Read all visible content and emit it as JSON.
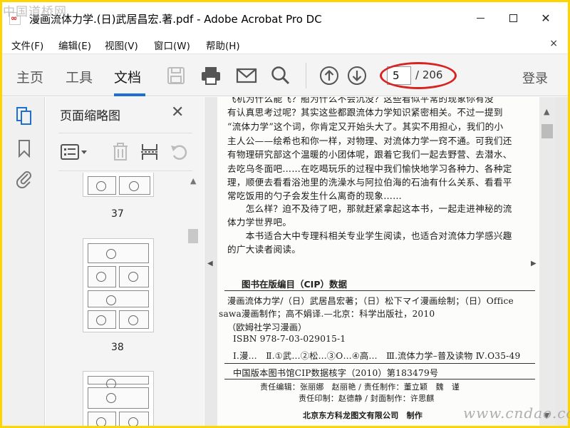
{
  "window": {
    "title": "漫画流体力学.(日)武居昌宏.著.pdf - Adobe Acrobat Pro DC",
    "close_glyph": "✕"
  },
  "menu": {
    "items": [
      "文件(F)",
      "编辑(E)",
      "视图(V)",
      "窗口(W)",
      "帮助(H)"
    ],
    "close_glyph": "×"
  },
  "toolbar": {
    "tabs": [
      "主页",
      "工具",
      "文档"
    ],
    "active_tab": "文档",
    "page_input_value": "5",
    "page_total": "/ 206",
    "login_label": "登录",
    "accent_color": "#1f6fd1",
    "highlight_color": "#d82323"
  },
  "thumbnails": {
    "panel_title": "页面缩略图",
    "close_glyph": "✕",
    "pages": [
      {
        "number": "37"
      },
      {
        "number": "38"
      }
    ]
  },
  "document": {
    "paragraph_lines": [
      "飞机为什么能飞？船为什么不会沉没？这些看似平常的现象你有没",
      "有认真思考过呢？其实这些都跟流体力学知识紧密相关。不过一提到",
      "“流体力学”这个词，你肯定又开始头大了。其实不用担心，我们的小",
      "主人公——绘希也和你一样，对物理、对流体力学一窍不通。可我们还",
      "有物理研究部这个温暖的小团体呢，跟着它我们一起去野营、去潜水、",
      "去吃乌冬面吧……在吃喝玩乐的过程中我们愉快地学习各种力、各种定",
      "理，顺便去看看浴池里的洗澡水与阿拉伯海的石油有什么关系、看看平",
      "常吃饭用的勺子会发生什么离奇的现象……",
      "　　怎么样？迫不及待了吧，那就赶紧拿起这本书，一起走进神秘的流",
      "体力学世界吧。",
      "　　本书适合大中专理科相关专业学生阅读，也适合对流体力学感兴趣",
      "的广大读者阅读。"
    ],
    "cip": {
      "heading": "图书在版编目（CIP）数据",
      "lines": [
        "漫画流体力学/（日）武居昌宏著；（日）松下マイ漫画绘制；（日）Office",
        "sawa漫画制作；高不娟译.—北京：科学出版社，2010",
        "（欧姆社学习漫画）",
        "ISBN 978-7-03-029015-1",
        "Ⅰ.漫…　Ⅱ.①武…②松…③O…④高…　Ⅲ.流体力学–普及读物 Ⅳ.O35-49",
        "中国版本图书馆CIP数据核字（2010）第183479号"
      ],
      "credits": [
        "责任编辑：张丽娜　赵丽艳 / 责任制作：董立颖　魏　谨",
        "责任印制：赵德静 / 封面制作：许思麒"
      ],
      "publisher": "北京东方科龙图文有限公司　制作"
    }
  },
  "watermarks": {
    "top_left": "中国道桥网",
    "bottom_right": "www.cndao.com"
  }
}
